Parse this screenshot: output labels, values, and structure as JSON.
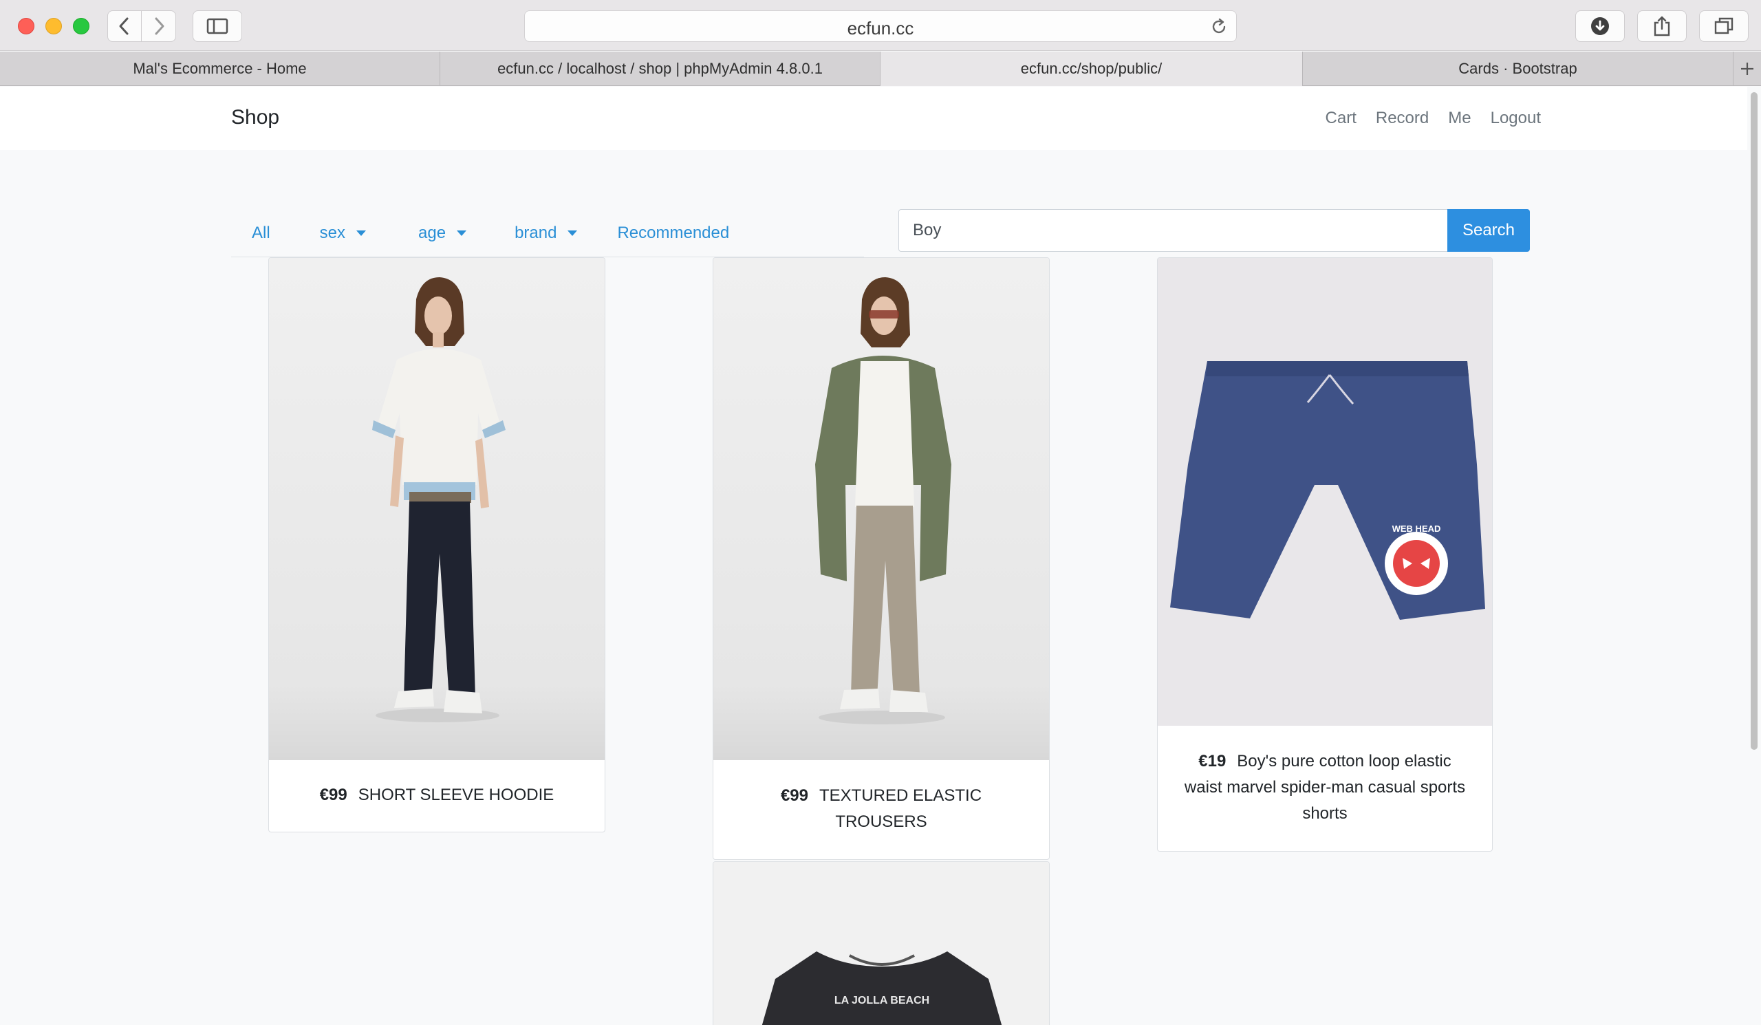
{
  "browser": {
    "url": "ecfun.cc",
    "tabs": [
      {
        "title": "Mal's Ecommerce - Home",
        "active": false
      },
      {
        "title": "ecfun.cc / localhost / shop | phpMyAdmin 4.8.0.1",
        "active": false
      },
      {
        "title": "ecfun.cc/shop/public/",
        "active": true
      },
      {
        "title": "Cards · Bootstrap",
        "active": false
      }
    ]
  },
  "navbar": {
    "brand": "Shop",
    "links": [
      "Cart",
      "Record",
      "Me",
      "Logout"
    ]
  },
  "filters": {
    "all": "All",
    "sex": "sex",
    "age": "age",
    "brand": "brand",
    "recommended": "Recommended"
  },
  "search": {
    "value": "Boy",
    "button": "Search"
  },
  "products": [
    {
      "price": "€99",
      "name": "SHORT SLEEVE HOODIE"
    },
    {
      "price": "€99",
      "name": "TEXTURED ELASTIC TROUSERS"
    },
    {
      "price": "€19",
      "name": "Boy's pure cotton loop elastic waist marvel spider-man casual sports shorts"
    },
    {
      "price": "",
      "name": ""
    }
  ],
  "print_logo_text": "LA JOLLA BEACH",
  "shorts_graphic_text": "WEB HEAD",
  "colors": {
    "link_blue": "#2a8fd6",
    "button_blue": "#2d8fe0"
  }
}
